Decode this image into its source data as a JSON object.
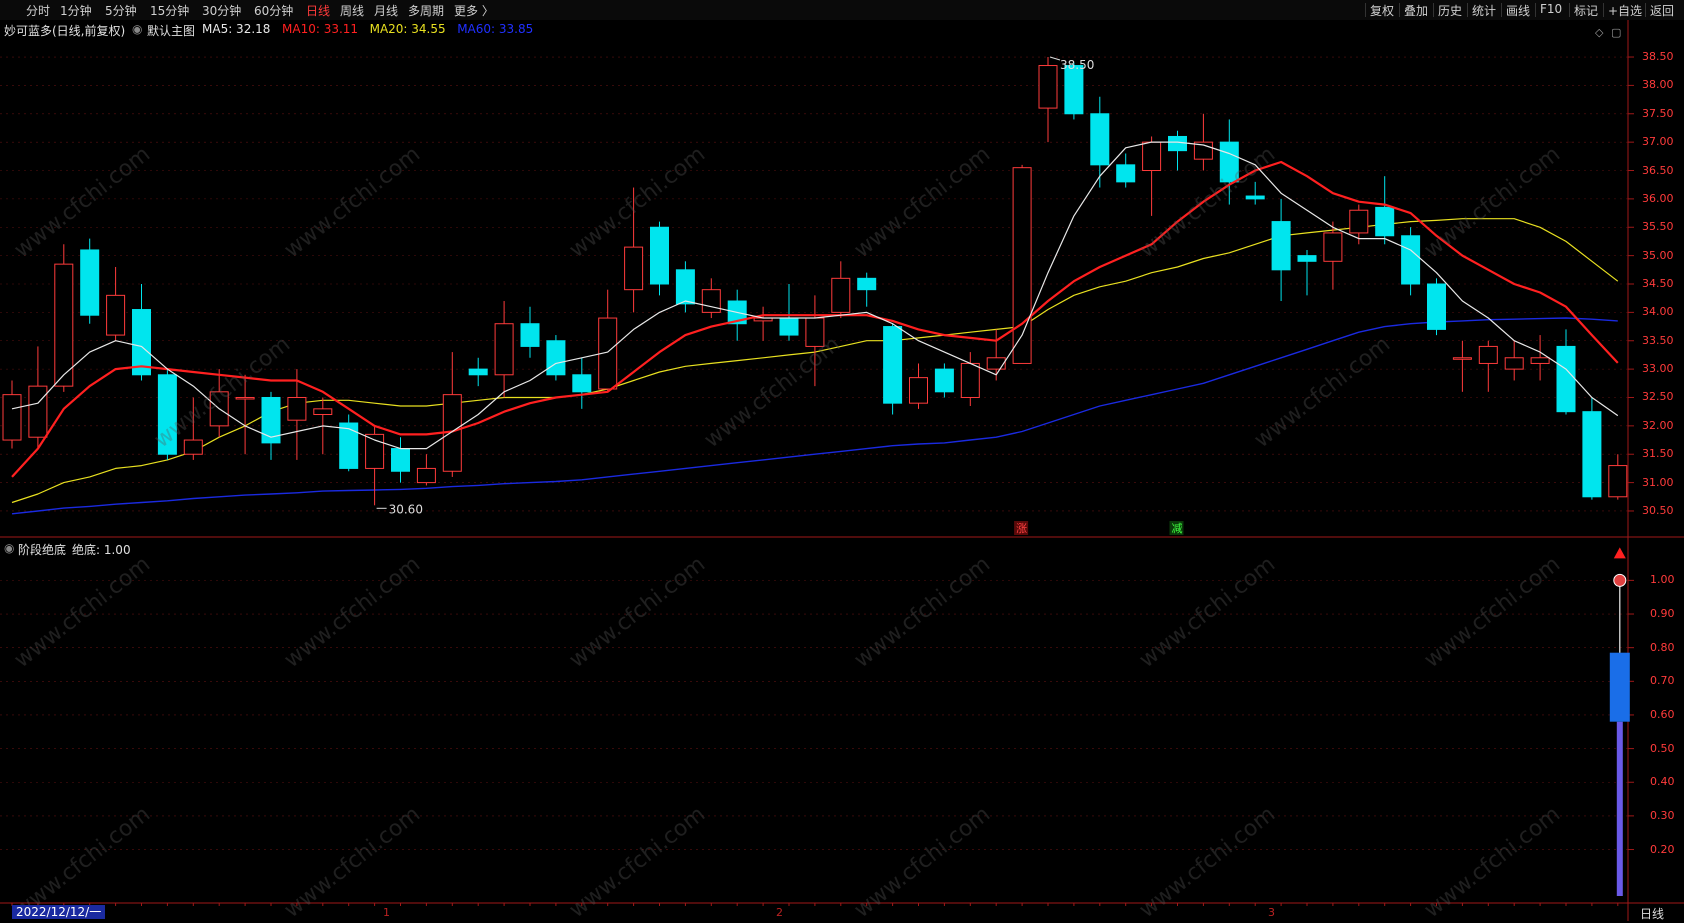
{
  "toolbar": {
    "left_items": [
      "分时",
      "1分钟",
      "5分钟",
      "15分钟",
      "30分钟",
      "60分钟",
      "日线",
      "周线",
      "月线",
      "多周期",
      "更多"
    ],
    "active_index": 6,
    "more_suffix": "〉",
    "right_items": [
      "复权",
      "叠加",
      "历史",
      "统计",
      "画线",
      "F10",
      "标记",
      "+自选",
      "返回"
    ]
  },
  "main_panel": {
    "stock_title": "妙可蓝多(日线,前复权)",
    "template": "默认主图",
    "ma": [
      {
        "label": "MA5: 32.18",
        "color": "#e8e8e8"
      },
      {
        "label": "MA10: 33.11",
        "color": "#ff2020"
      },
      {
        "label": "MA20: 34.55",
        "color": "#e8e020"
      },
      {
        "label": "MA60: 33.85",
        "color": "#2030ff"
      }
    ],
    "high_marker": "38.50",
    "low_marker": "30.60",
    "zhang_label": "涨",
    "jian_label": "减"
  },
  "indicator_panel": {
    "name": "阶段绝底",
    "value_label": "绝底: 1.00"
  },
  "price_axis": [
    "38.50",
    "38.00",
    "37.50",
    "37.00",
    "36.50",
    "36.00",
    "35.50",
    "35.00",
    "34.50",
    "34.00",
    "33.50",
    "33.00",
    "32.50",
    "32.00",
    "31.50",
    "31.00",
    "30.50"
  ],
  "indicator_axis": [
    "1.00",
    "0.90",
    "0.80",
    "0.70",
    "0.60",
    "0.50",
    "0.40",
    "0.30",
    "0.20"
  ],
  "date_cursor": "2022/12/12/一",
  "x_labels": [
    "1",
    "2",
    "3"
  ],
  "period": "日线",
  "watermark": "www.cfchi.com",
  "colors": {
    "up": "#ff3b3b",
    "down": "#00e5ee",
    "ma5": "#e8e8e8",
    "ma10": "#ff2020",
    "ma20": "#e8e020",
    "ma60": "#1a2ae0",
    "grid": "#5a1010"
  },
  "chart_data": {
    "type": "candlestick",
    "y_range": [
      30.2,
      38.8
    ],
    "candles": [
      {
        "o": 31.75,
        "c": 32.55,
        "h": 32.8,
        "l": 31.6
      },
      {
        "o": 31.8,
        "c": 32.7,
        "h": 33.4,
        "l": 31.6
      },
      {
        "o": 32.7,
        "c": 34.85,
        "h": 35.2,
        "l": 32.6
      },
      {
        "o": 35.1,
        "c": 33.95,
        "h": 35.3,
        "l": 33.8
      },
      {
        "o": 33.6,
        "c": 34.3,
        "h": 34.8,
        "l": 33.5
      },
      {
        "o": 34.05,
        "c": 32.9,
        "h": 34.5,
        "l": 32.8
      },
      {
        "o": 32.9,
        "c": 31.5,
        "h": 33.0,
        "l": 31.4
      },
      {
        "o": 31.5,
        "c": 31.75,
        "h": 32.5,
        "l": 31.4
      },
      {
        "o": 32.0,
        "c": 32.6,
        "h": 33.0,
        "l": 31.8
      },
      {
        "o": 32.5,
        "c": 32.5,
        "h": 32.9,
        "l": 31.5
      },
      {
        "o": 32.5,
        "c": 31.7,
        "h": 32.6,
        "l": 31.4
      },
      {
        "o": 32.1,
        "c": 32.5,
        "h": 33.0,
        "l": 31.4
      },
      {
        "o": 32.2,
        "c": 32.3,
        "h": 32.5,
        "l": 31.5
      },
      {
        "o": 32.05,
        "c": 31.25,
        "h": 32.2,
        "l": 31.2
      },
      {
        "o": 31.25,
        "c": 31.85,
        "h": 32.0,
        "l": 30.6
      },
      {
        "o": 31.6,
        "c": 31.2,
        "h": 31.8,
        "l": 31.0
      },
      {
        "o": 31.0,
        "c": 31.25,
        "h": 31.5,
        "l": 30.95
      },
      {
        "o": 31.2,
        "c": 32.55,
        "h": 33.3,
        "l": 31.1
      },
      {
        "o": 33.0,
        "c": 32.9,
        "h": 33.2,
        "l": 32.7
      },
      {
        "o": 32.9,
        "c": 33.8,
        "h": 34.2,
        "l": 32.5
      },
      {
        "o": 33.8,
        "c": 33.4,
        "h": 34.1,
        "l": 33.2
      },
      {
        "o": 33.5,
        "c": 32.9,
        "h": 33.6,
        "l": 32.8
      },
      {
        "o": 32.9,
        "c": 32.6,
        "h": 33.2,
        "l": 32.3
      },
      {
        "o": 32.65,
        "c": 33.9,
        "h": 34.4,
        "l": 32.6
      },
      {
        "o": 34.4,
        "c": 35.15,
        "h": 36.2,
        "l": 34.0
      },
      {
        "o": 35.5,
        "c": 34.5,
        "h": 35.6,
        "l": 34.3
      },
      {
        "o": 34.75,
        "c": 34.15,
        "h": 34.9,
        "l": 34.0
      },
      {
        "o": 34.0,
        "c": 34.4,
        "h": 34.6,
        "l": 33.9
      },
      {
        "o": 34.2,
        "c": 33.8,
        "h": 34.4,
        "l": 33.5
      },
      {
        "o": 33.85,
        "c": 33.9,
        "h": 34.1,
        "l": 33.5
      },
      {
        "o": 33.9,
        "c": 33.6,
        "h": 34.5,
        "l": 33.5
      },
      {
        "o": 33.4,
        "c": 33.9,
        "h": 34.3,
        "l": 32.7
      },
      {
        "o": 34.0,
        "c": 34.6,
        "h": 34.9,
        "l": 33.9
      },
      {
        "o": 34.6,
        "c": 34.4,
        "h": 34.7,
        "l": 34.1
      },
      {
        "o": 33.75,
        "c": 32.4,
        "h": 33.8,
        "l": 32.2
      },
      {
        "o": 32.4,
        "c": 32.85,
        "h": 33.1,
        "l": 32.3
      },
      {
        "o": 33.0,
        "c": 32.6,
        "h": 33.1,
        "l": 32.5
      },
      {
        "o": 32.5,
        "c": 33.1,
        "h": 33.3,
        "l": 32.35
      },
      {
        "o": 33.0,
        "c": 33.2,
        "h": 33.7,
        "l": 32.8
      },
      {
        "o": 33.1,
        "c": 36.55,
        "h": 36.6,
        "l": 33.1
      },
      {
        "o": 37.6,
        "c": 38.35,
        "h": 38.5,
        "l": 37.0
      },
      {
        "o": 38.35,
        "c": 37.5,
        "h": 38.4,
        "l": 37.4
      },
      {
        "o": 37.5,
        "c": 36.6,
        "h": 37.8,
        "l": 36.2
      },
      {
        "o": 36.6,
        "c": 36.3,
        "h": 36.8,
        "l": 36.2
      },
      {
        "o": 36.5,
        "c": 37.0,
        "h": 37.1,
        "l": 35.7
      },
      {
        "o": 37.1,
        "c": 36.85,
        "h": 37.2,
        "l": 36.5
      },
      {
        "o": 36.7,
        "c": 37.0,
        "h": 37.5,
        "l": 36.5
      },
      {
        "o": 37.0,
        "c": 36.3,
        "h": 37.4,
        "l": 35.9
      },
      {
        "o": 36.05,
        "c": 36.0,
        "h": 36.3,
        "l": 35.9
      },
      {
        "o": 35.6,
        "c": 34.75,
        "h": 36.0,
        "l": 34.2
      },
      {
        "o": 35.0,
        "c": 34.9,
        "h": 35.1,
        "l": 34.3
      },
      {
        "o": 34.9,
        "c": 35.4,
        "h": 35.6,
        "l": 34.4
      },
      {
        "o": 35.4,
        "c": 35.8,
        "h": 35.9,
        "l": 35.2
      },
      {
        "o": 35.85,
        "c": 35.35,
        "h": 36.4,
        "l": 35.2
      },
      {
        "o": 35.35,
        "c": 34.5,
        "h": 35.5,
        "l": 34.3
      },
      {
        "o": 34.5,
        "c": 33.7,
        "h": 34.6,
        "l": 33.6
      },
      {
        "o": 33.2,
        "c": 33.2,
        "h": 33.5,
        "l": 32.6
      },
      {
        "o": 33.1,
        "c": 33.4,
        "h": 33.5,
        "l": 32.6
      },
      {
        "o": 33.0,
        "c": 33.2,
        "h": 33.5,
        "l": 32.8
      },
      {
        "o": 33.1,
        "c": 33.2,
        "h": 33.6,
        "l": 32.8
      },
      {
        "o": 33.4,
        "c": 32.25,
        "h": 33.7,
        "l": 32.2
      },
      {
        "o": 32.25,
        "c": 30.75,
        "h": 32.5,
        "l": 30.7
      },
      {
        "o": 30.75,
        "c": 31.3,
        "h": 31.5,
        "l": 30.7
      }
    ],
    "ma5": [
      32.3,
      32.4,
      32.9,
      33.3,
      33.5,
      33.4,
      33.0,
      32.7,
      32.3,
      32.0,
      31.8,
      31.9,
      32.0,
      31.95,
      31.75,
      31.6,
      31.6,
      31.9,
      32.2,
      32.6,
      32.8,
      33.1,
      33.2,
      33.3,
      33.7,
      34.0,
      34.2,
      34.1,
      34.0,
      33.9,
      33.9,
      33.9,
      33.95,
      34.0,
      33.8,
      33.5,
      33.3,
      33.1,
      32.9,
      33.6,
      34.7,
      35.7,
      36.4,
      36.9,
      37.0,
      37.0,
      36.95,
      36.8,
      36.6,
      36.1,
      35.8,
      35.5,
      35.3,
      35.3,
      35.1,
      34.7,
      34.2,
      33.9,
      33.5,
      33.3,
      33.0,
      32.5,
      32.18
    ],
    "ma10": [
      31.1,
      31.6,
      32.3,
      32.7,
      33.0,
      33.05,
      33.0,
      32.95,
      32.9,
      32.85,
      32.8,
      32.8,
      32.6,
      32.3,
      32.0,
      31.85,
      31.85,
      31.9,
      32.05,
      32.25,
      32.4,
      32.5,
      32.55,
      32.6,
      32.95,
      33.3,
      33.6,
      33.75,
      33.85,
      33.95,
      33.95,
      33.95,
      33.95,
      33.95,
      33.85,
      33.7,
      33.6,
      33.55,
      33.5,
      33.8,
      34.2,
      34.55,
      34.8,
      35.0,
      35.2,
      35.6,
      35.95,
      36.25,
      36.5,
      36.65,
      36.4,
      36.1,
      35.95,
      35.9,
      35.75,
      35.35,
      35.0,
      34.75,
      34.5,
      34.35,
      34.1,
      33.6,
      33.11
    ],
    "ma20": [
      30.65,
      30.8,
      31.0,
      31.1,
      31.25,
      31.3,
      31.4,
      31.55,
      31.8,
      32.0,
      32.25,
      32.4,
      32.45,
      32.45,
      32.4,
      32.35,
      32.35,
      32.4,
      32.45,
      32.5,
      32.5,
      32.5,
      32.55,
      32.65,
      32.8,
      32.95,
      33.05,
      33.1,
      33.15,
      33.2,
      33.25,
      33.3,
      33.4,
      33.5,
      33.5,
      33.55,
      33.6,
      33.65,
      33.7,
      33.75,
      34.05,
      34.3,
      34.45,
      34.55,
      34.7,
      34.8,
      34.95,
      35.05,
      35.2,
      35.35,
      35.4,
      35.45,
      35.5,
      35.55,
      35.6,
      35.62,
      35.65,
      35.65,
      35.65,
      35.5,
      35.25,
      34.9,
      34.55
    ],
    "ma60": [
      30.45,
      30.5,
      30.55,
      30.58,
      30.62,
      30.65,
      30.68,
      30.72,
      30.75,
      30.78,
      30.8,
      30.82,
      30.85,
      30.86,
      30.87,
      30.88,
      30.9,
      30.93,
      30.95,
      30.98,
      31.0,
      31.02,
      31.05,
      31.1,
      31.15,
      31.2,
      31.25,
      31.3,
      31.35,
      31.4,
      31.45,
      31.5,
      31.55,
      31.6,
      31.65,
      31.68,
      31.7,
      31.75,
      31.8,
      31.9,
      32.05,
      32.2,
      32.35,
      32.45,
      32.55,
      32.65,
      32.75,
      32.9,
      33.05,
      33.2,
      33.35,
      33.5,
      33.65,
      33.75,
      33.8,
      33.83,
      33.85,
      33.87,
      33.88,
      33.89,
      33.9,
      33.88,
      33.85
    ],
    "indicator": {
      "name": "绝底",
      "last_value": 1.0,
      "y_range": [
        0.05,
        1.12
      ],
      "bar_top": 0.785,
      "bar_bottom": 0.58
    }
  }
}
